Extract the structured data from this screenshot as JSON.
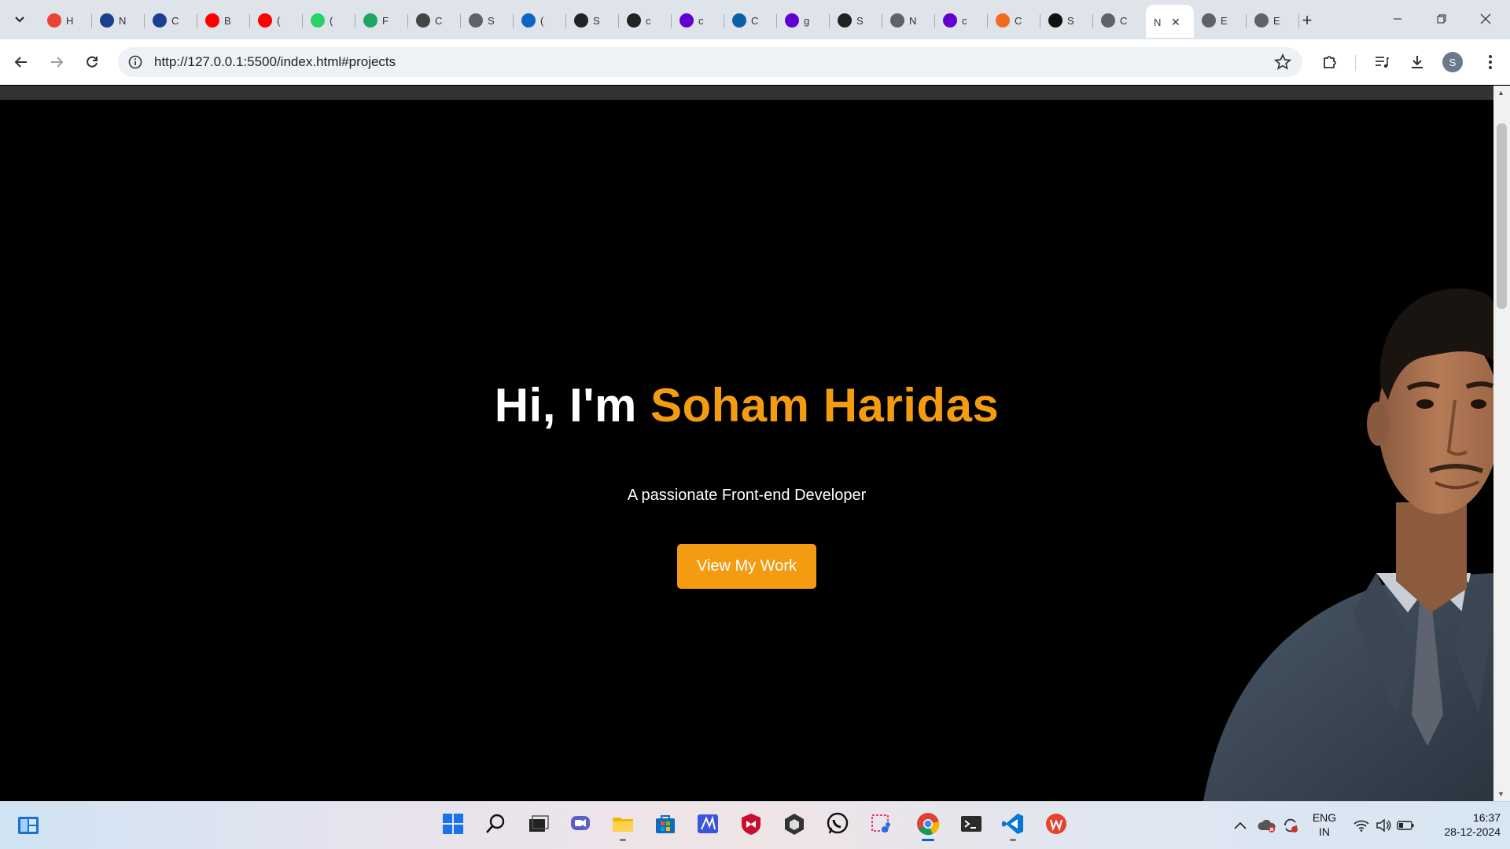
{
  "browser": {
    "url": "http://127.0.0.1:5500/index.html#projects",
    "tabs": [
      {
        "title": "H",
        "icon": "gmail-icon",
        "color": "#ea4335"
      },
      {
        "title": "N",
        "icon": "meta-icon",
        "color": "#1a3f8f"
      },
      {
        "title": "C",
        "icon": "meta-icon",
        "color": "#1a3f8f"
      },
      {
        "title": "B",
        "icon": "youtube-icon",
        "color": "#ff0000"
      },
      {
        "title": "(",
        "icon": "youtube-icon",
        "color": "#ff0000"
      },
      {
        "title": "(",
        "icon": "whatsapp-icon",
        "color": "#25d366"
      },
      {
        "title": "F",
        "icon": "google-drive-icon",
        "color": "#1fa463"
      },
      {
        "title": "C",
        "icon": "chatgpt-icon",
        "color": "#444444"
      },
      {
        "title": "S",
        "icon": "globe-icon",
        "color": "#5f6368"
      },
      {
        "title": "(",
        "icon": "linkedin-icon",
        "color": "#0a66c2"
      },
      {
        "title": "S",
        "icon": "github-icon",
        "color": "#222222"
      },
      {
        "title": "c",
        "icon": "github-icon",
        "color": "#222222"
      },
      {
        "title": "c",
        "icon": "yahoo-icon",
        "color": "#6001d2"
      },
      {
        "title": "C",
        "icon": "circle-icon",
        "color": "#0b5fa5"
      },
      {
        "title": "g",
        "icon": "yahoo-icon",
        "color": "#6001d2"
      },
      {
        "title": "S",
        "icon": "github-icon",
        "color": "#222222"
      },
      {
        "title": "N",
        "icon": "globe-icon",
        "color": "#5f6368"
      },
      {
        "title": "c",
        "icon": "yahoo-icon",
        "color": "#6001d2"
      },
      {
        "title": "C",
        "icon": "diamond-icon",
        "color": "#f26b1d"
      },
      {
        "title": "S",
        "icon": "dots-icon",
        "color": "#111111"
      },
      {
        "title": "C",
        "icon": "globe-icon",
        "color": "#5f6368"
      },
      {
        "title": "N",
        "icon": "none",
        "color": "#ffffff",
        "active": true
      },
      {
        "title": "E",
        "icon": "globe-icon",
        "color": "#5f6368"
      },
      {
        "title": "E",
        "icon": "globe-icon",
        "color": "#5f6368"
      }
    ],
    "profile_initial": "S"
  },
  "page": {
    "hero_greeting": "Hi, I'm ",
    "hero_name": "Soham Haridas",
    "hero_subtitle": "A passionate Front-end Developer",
    "cta_label": "View My Work",
    "accent_color": "#f39c12"
  },
  "taskbar": {
    "apps": [
      "start-icon",
      "search-icon",
      "task-view-icon",
      "teams-icon",
      "file-explorer-icon",
      "store-icon",
      "mathpix-icon",
      "mcafee-icon",
      "unity-icon",
      "whatsapp-icon",
      "snipping-tool-icon",
      "chrome-icon",
      "terminal-icon",
      "vscode-icon",
      "wps-office-icon"
    ],
    "language": "ENG",
    "region": "IN",
    "time": "16:37",
    "date": "28-12-2024"
  }
}
